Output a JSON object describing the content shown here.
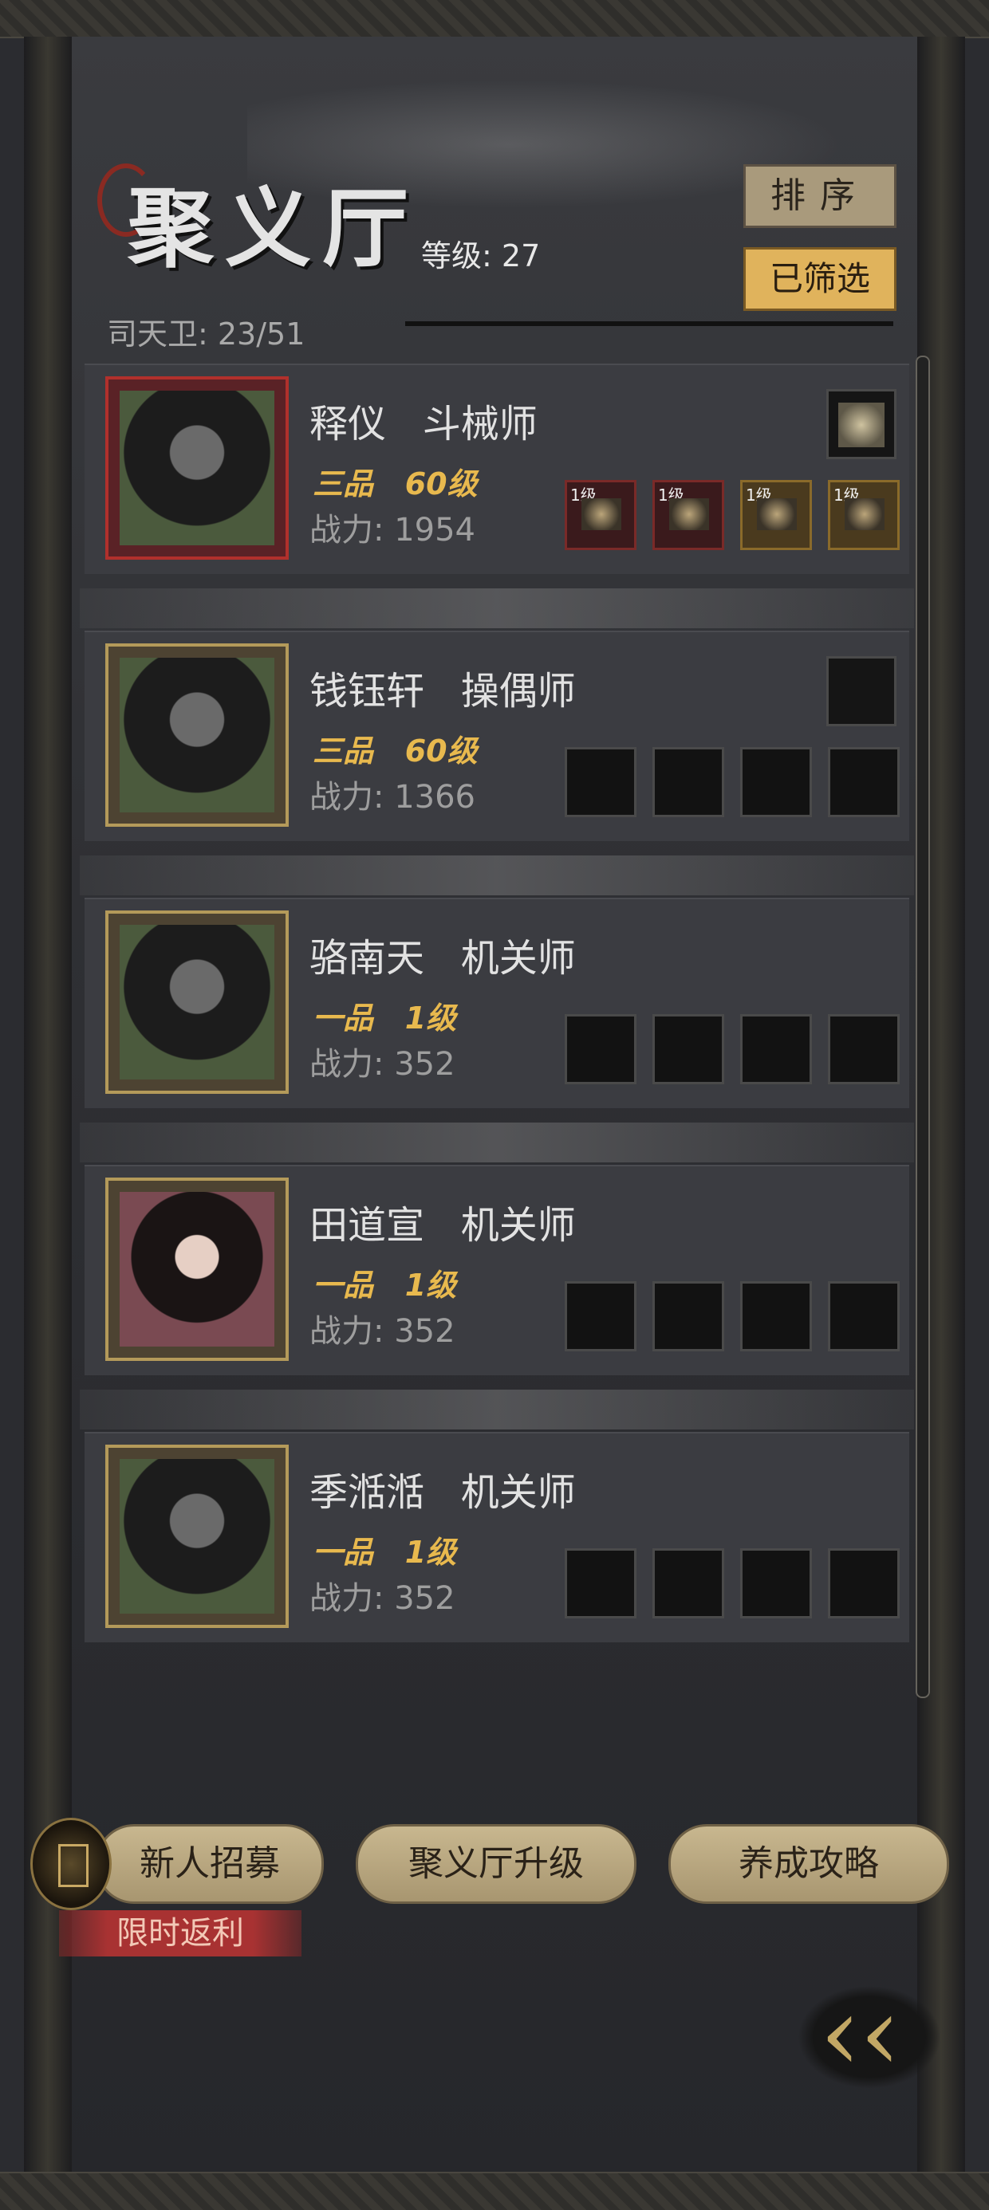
{
  "header": {
    "title": "聚义厅",
    "level_label": "等级:",
    "level_value": "27",
    "guard_count": "司天卫: 23/51",
    "sort_button": "排序",
    "filter_button": "已筛选"
  },
  "characters": [
    {
      "name": "释仪",
      "profession": "斗械师",
      "rank": "三品",
      "level": "60级",
      "power_label": "战力:",
      "power": "1954",
      "frame_color": "red",
      "equipment": [
        {
          "level": "1级",
          "item": "crossbow-icon"
        },
        {
          "level": "1级",
          "item": "armor-icon"
        },
        {
          "level": "1级",
          "item": "pouch-icon"
        },
        {
          "level": "1级",
          "item": "boots-icon"
        }
      ],
      "accessory": "comb-icon"
    },
    {
      "name": "钱钰轩",
      "profession": "操偶师",
      "rank": "三品",
      "level": "60级",
      "power_label": "战力:",
      "power": "1366",
      "frame_color": "gold",
      "equipment": [],
      "accessory": ""
    },
    {
      "name": "骆南天",
      "profession": "机关师",
      "rank": "一品",
      "level": "1级",
      "power_label": "战力:",
      "power": "352",
      "frame_color": "gold",
      "equipment": [],
      "accessory": ""
    },
    {
      "name": "田道宣",
      "profession": "机关师",
      "rank": "一品",
      "level": "1级",
      "power_label": "战力:",
      "power": "352",
      "frame_color": "gold",
      "equipment": [],
      "accessory": ""
    },
    {
      "name": "季湉湉",
      "profession": "机关师",
      "rank": "一品",
      "level": "1级",
      "power_label": "战力:",
      "power": "352",
      "frame_color": "gold",
      "equipment": [],
      "accessory": ""
    }
  ],
  "footer": {
    "recruit_button": "新人招募",
    "upgrade_button": "聚义厅升级",
    "guide_button": "养成攻略",
    "promo_tag": "限时返利"
  },
  "colors": {
    "accent_gold": "#e0b35c",
    "rank_gold": "#e8b94e",
    "promo_red": "#a83232",
    "frame_red": "#b1302c"
  }
}
